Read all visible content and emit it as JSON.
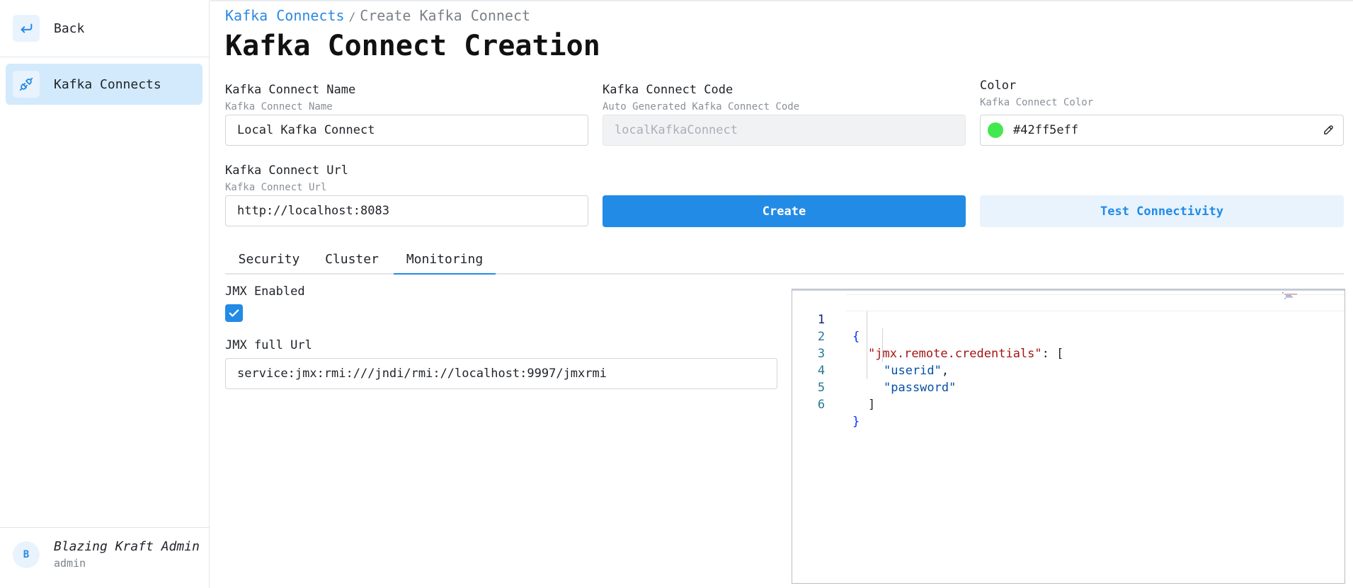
{
  "sidebar": {
    "back_label": "Back",
    "items": [
      {
        "label": "Kafka Connects",
        "icon": "plug-icon"
      }
    ],
    "user": {
      "initial": "B",
      "name": "Blazing Kraft Admin",
      "role": "admin"
    }
  },
  "breadcrumb": {
    "parent": "Kafka Connects",
    "separator": "/",
    "current": "Create Kafka Connect"
  },
  "page_title": "Kafka Connect Creation",
  "form": {
    "name": {
      "label": "Kafka Connect Name",
      "description": "Kafka Connect Name",
      "value": "Local Kafka Connect"
    },
    "code": {
      "label": "Kafka Connect Code",
      "description": "Auto Generated Kafka Connect Code",
      "value": "localKafkaConnect"
    },
    "color": {
      "label": "Color",
      "description": "Kafka Connect Color",
      "value": "#42ff5eff",
      "swatch": "#42e84f"
    },
    "url": {
      "label": "Kafka Connect Url",
      "description": "Kafka Connect Url",
      "value": "http://localhost:8083"
    }
  },
  "buttons": {
    "create": "Create",
    "test": "Test Connectivity"
  },
  "tabs": [
    {
      "label": "Security",
      "active": false
    },
    {
      "label": "Cluster",
      "active": false
    },
    {
      "label": "Monitoring",
      "active": true
    }
  ],
  "monitoring": {
    "jmx_enabled_label": "JMX Enabled",
    "jmx_enabled": true,
    "jmx_url_label": "JMX full Url",
    "jmx_url_value": "service:jmx:rmi:///jndi/rmi://localhost:9997/jmxrmi"
  },
  "editor": {
    "line_numbers": [
      "1",
      "2",
      "3",
      "4",
      "5",
      "6"
    ],
    "lines": {
      "l1": "{",
      "l2_key": "\"jmx.remote.credentials\"",
      "l2_rest": ": [",
      "l3_str": "\"userid\"",
      "l3_rest": ",",
      "l4_str": "\"password\"",
      "l5": "]",
      "l6": "}"
    }
  },
  "colors": {
    "accent": "#228be6",
    "accent_light": "#e8f3fd",
    "active_nav": "#d3eafc"
  }
}
